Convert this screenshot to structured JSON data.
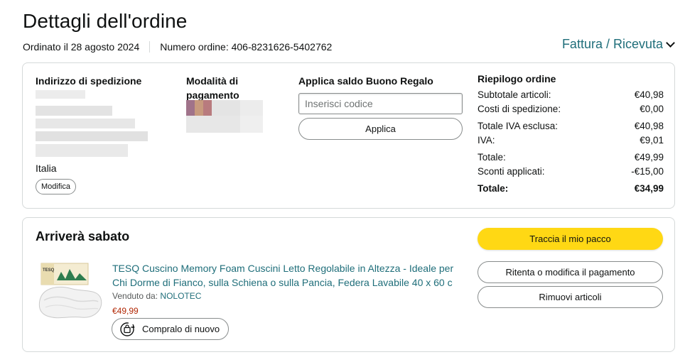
{
  "page": {
    "title": "Dettagli dell'ordine",
    "order_date": "Ordinato il 28 agosto 2024",
    "order_number": "Numero ordine: 406-8231626-5402762",
    "invoice_link": "Fattura / Ricevuta"
  },
  "shipping": {
    "heading": "Indirizzo di spedizione",
    "country": "Italia",
    "edit_label": "Modifica"
  },
  "payment": {
    "heading": "Modalità di pagamento"
  },
  "gift": {
    "heading": "Applica saldo Buono Regalo",
    "placeholder": "Inserisci codice",
    "apply_label": "Applica"
  },
  "summary": {
    "heading": "Riepilogo ordine",
    "rows": [
      {
        "label": "Subtotale articoli:",
        "value": "€40,98"
      },
      {
        "label": "Costi di spedizione:",
        "value": "€0,00"
      },
      {
        "label": "Totale IVA esclusa:",
        "value": "€40,98"
      },
      {
        "label": "IVA:",
        "value": "€9,01"
      },
      {
        "label": "Totale:",
        "value": "€49,99"
      },
      {
        "label": "Sconti applicati:",
        "value": "-€15,00"
      },
      {
        "label": "Totale:",
        "value": "€34,99"
      }
    ]
  },
  "delivery": {
    "heading": "Arriverà sabato",
    "track_label": "Traccia il mio pacco",
    "retry_label": "Ritenta o modifica il pagamento",
    "remove_label": "Rimuovi articoli"
  },
  "product": {
    "title": "TESQ Cuscino Memory Foam Cuscini Letto Regolabile in Altezza - Ideale per Chi Dorme di Fianco, sulla Schiena o sulla Pancia, Federa Lavabile 40 x 60 c",
    "sold_by_label": "Venduto da:",
    "seller": "NOLOTEC",
    "price": "€49,99",
    "buy_again_label": "Compralo di nuovo",
    "image_icon": "pillow-product-image"
  },
  "colors": {
    "link": "#1f6e7a",
    "price": "#b12704",
    "track_button": "#ffd814",
    "border": "#d5d9d9"
  }
}
